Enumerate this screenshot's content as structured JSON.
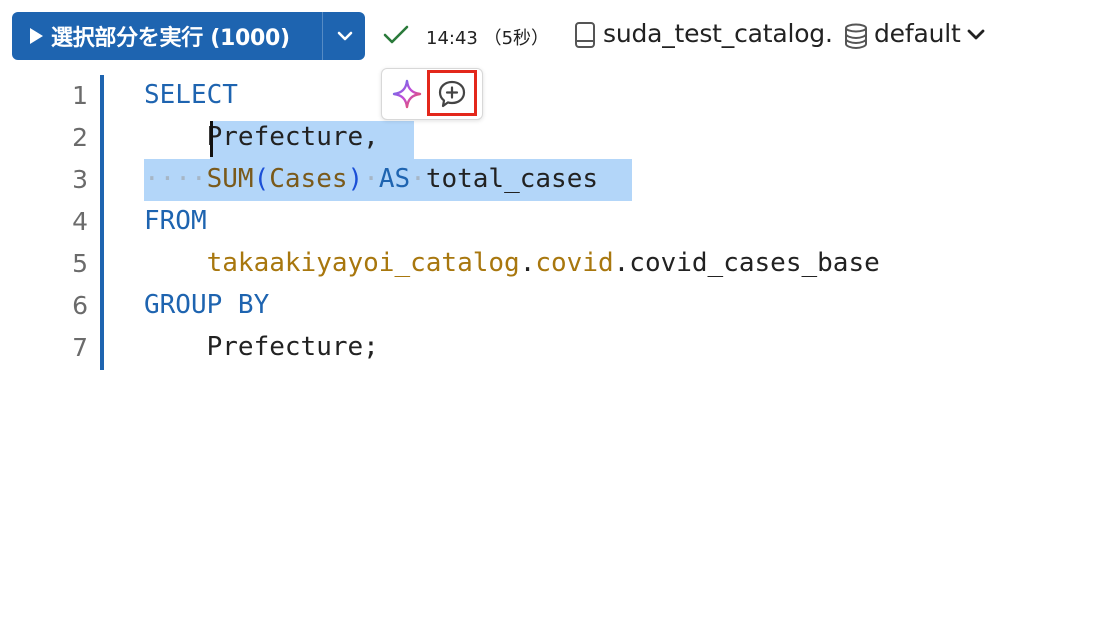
{
  "toolbar": {
    "run_label": "選択部分を実行 (1000)",
    "status_time": "14:43 （5秒）",
    "catalog": "suda_test_catalog",
    "separator": ".",
    "schema": "default"
  },
  "icons": {
    "run": "play-icon",
    "run_menu": "chevron-down-icon",
    "status": "check-icon",
    "catalog": "catalog-icon",
    "schema": "database-icon",
    "assistant": "sparkle-icon",
    "comment": "add-comment-icon"
  },
  "colors": {
    "accent": "#1e64b0",
    "selection": "#b3d6f9",
    "highlight_box": "#e3271b",
    "status_ok": "#2a7a3a"
  },
  "editor": {
    "lines": [
      {
        "num": "1",
        "tokens": [
          {
            "t": "SELECT",
            "c": "kw"
          }
        ]
      },
      {
        "num": "2",
        "tokens": [
          {
            "t": "    ",
            "c": ""
          },
          {
            "t": "Prefecture,",
            "c": ""
          }
        ]
      },
      {
        "num": "3",
        "tokens": [
          {
            "t": "····",
            "c": "ws-dot"
          },
          {
            "t": "SUM",
            "c": "fn"
          },
          {
            "t": "(",
            "c": "paren"
          },
          {
            "t": "Cases",
            "c": "fn"
          },
          {
            "t": ")",
            "c": "paren"
          },
          {
            "t": "·",
            "c": "ws-dot"
          },
          {
            "t": "AS",
            "c": "kw"
          },
          {
            "t": "·",
            "c": "ws-dot"
          },
          {
            "t": "total_cases",
            "c": ""
          }
        ]
      },
      {
        "num": "4",
        "tokens": [
          {
            "t": "FROM",
            "c": "kw"
          }
        ]
      },
      {
        "num": "5",
        "tokens": [
          {
            "t": "    ",
            "c": ""
          },
          {
            "t": "takaakiyayoi_catalog",
            "c": "id-gold"
          },
          {
            "t": ".",
            "c": ""
          },
          {
            "t": "covid",
            "c": "id-gold"
          },
          {
            "t": ".covid_cases_base",
            "c": ""
          }
        ]
      },
      {
        "num": "6",
        "tokens": [
          {
            "t": "GROUP BY",
            "c": "kw"
          }
        ]
      },
      {
        "num": "7",
        "tokens": [
          {
            "t": "    ",
            "c": ""
          },
          {
            "t": "Prefecture;",
            "c": ""
          }
        ]
      }
    ]
  }
}
